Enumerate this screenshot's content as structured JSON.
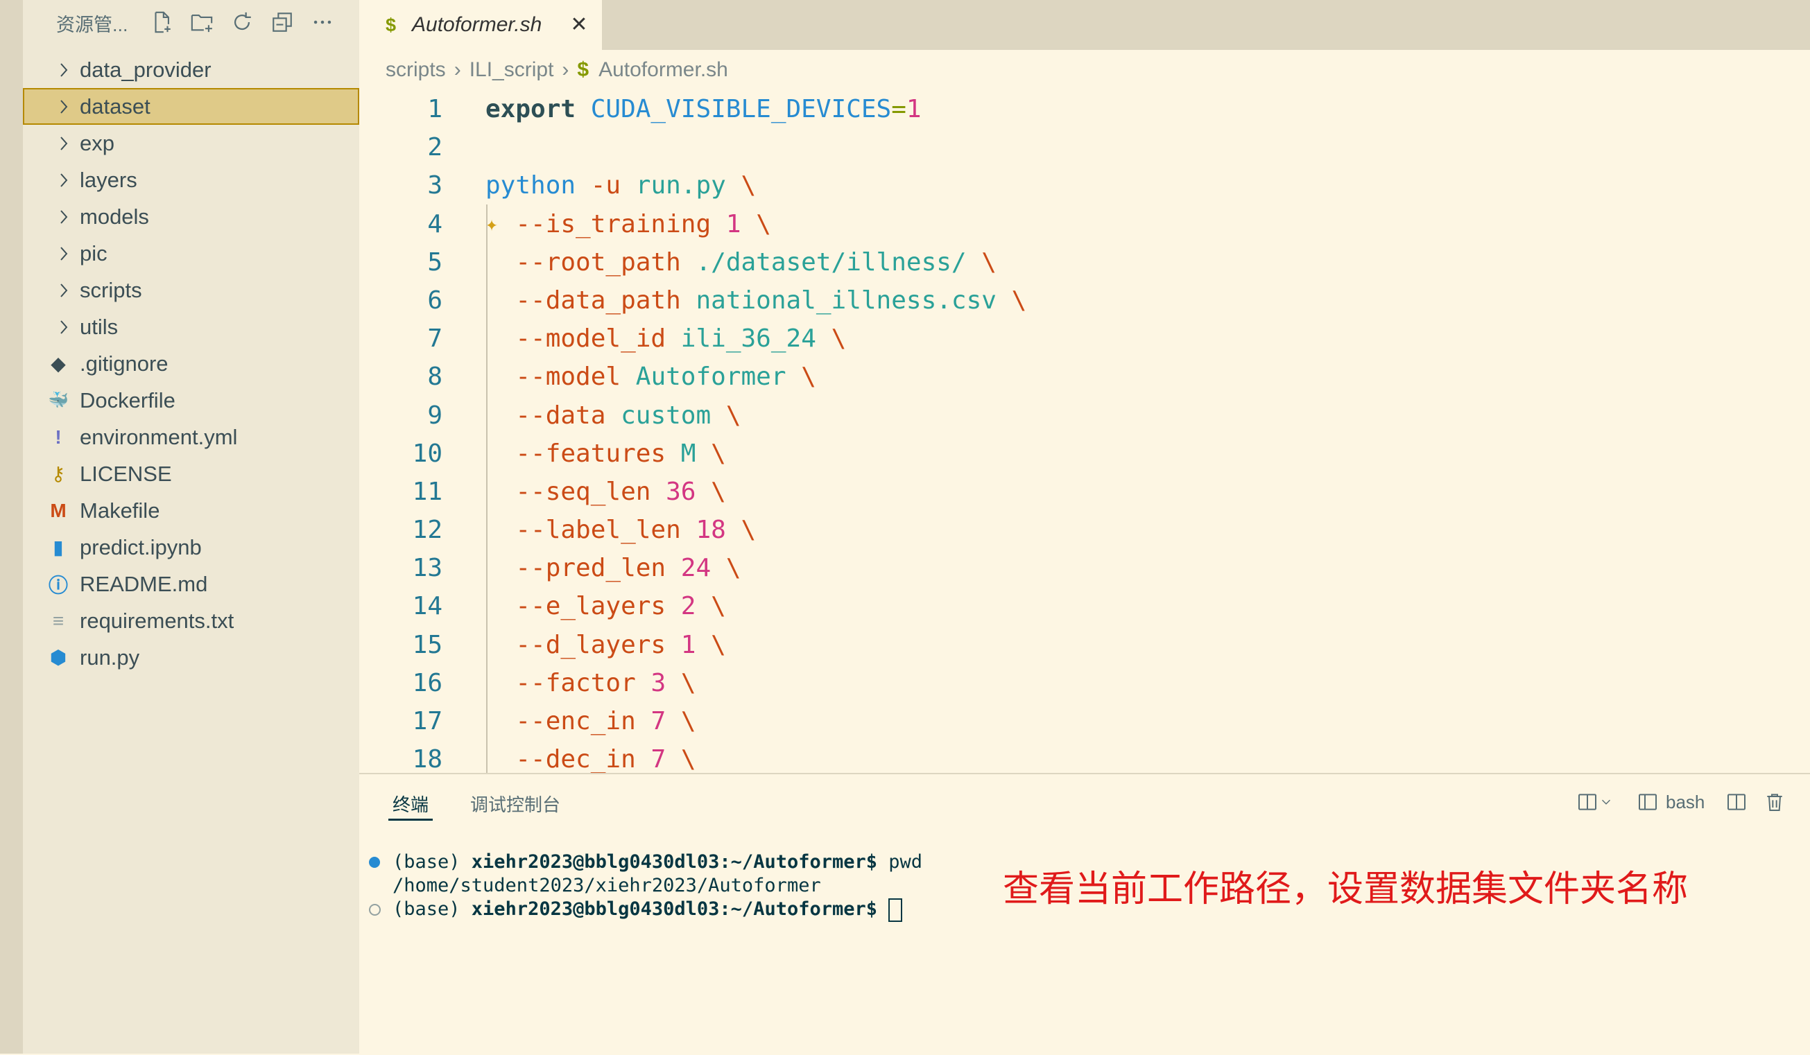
{
  "sidebar": {
    "title": "资源管...",
    "tools": [
      "new-file-icon",
      "new-folder-icon",
      "refresh-icon",
      "collapse-icon",
      "more-icon"
    ],
    "items": [
      {
        "label": "data_provider",
        "kind": "folder"
      },
      {
        "label": "dataset",
        "kind": "folder",
        "selected": true
      },
      {
        "label": "exp",
        "kind": "folder"
      },
      {
        "label": "layers",
        "kind": "folder"
      },
      {
        "label": "models",
        "kind": "folder"
      },
      {
        "label": "pic",
        "kind": "folder"
      },
      {
        "label": "scripts",
        "kind": "folder"
      },
      {
        "label": "utils",
        "kind": "folder"
      },
      {
        "label": ".gitignore",
        "kind": "git"
      },
      {
        "label": "Dockerfile",
        "kind": "docker"
      },
      {
        "label": "environment.yml",
        "kind": "yml"
      },
      {
        "label": "LICENSE",
        "kind": "license"
      },
      {
        "label": "Makefile",
        "kind": "makefile"
      },
      {
        "label": "predict.ipynb",
        "kind": "notebook"
      },
      {
        "label": "README.md",
        "kind": "info"
      },
      {
        "label": "requirements.txt",
        "kind": "text"
      },
      {
        "label": "run.py",
        "kind": "python"
      }
    ]
  },
  "editor": {
    "tab": {
      "icon": "$",
      "label": "Autoformer.sh"
    },
    "breadcrumb": [
      "scripts",
      "ILI_script",
      "Autoformer.sh"
    ],
    "lines": [
      {
        "n": "1",
        "tokens": [
          [
            "kw",
            "export"
          ],
          [
            "",
            " "
          ],
          [
            "var",
            "CUDA_VISIBLE_DEVICES"
          ],
          [
            "op",
            "="
          ],
          [
            "num",
            "1"
          ]
        ]
      },
      {
        "n": "2",
        "tokens": []
      },
      {
        "n": "3",
        "tokens": [
          [
            "var",
            "python"
          ],
          [
            "",
            " "
          ],
          [
            "flag",
            "-u"
          ],
          [
            "",
            " "
          ],
          [
            "str",
            "run.py"
          ],
          [
            "",
            " "
          ],
          [
            "bs",
            "\\"
          ]
        ]
      },
      {
        "n": "4",
        "tokens": [
          [
            "",
            "  "
          ],
          [
            "flag",
            "--is_training"
          ],
          [
            "",
            " "
          ],
          [
            "num",
            "1"
          ],
          [
            "",
            " "
          ],
          [
            "bs",
            "\\"
          ]
        ]
      },
      {
        "n": "5",
        "tokens": [
          [
            "",
            "  "
          ],
          [
            "flag",
            "--root_path"
          ],
          [
            "",
            " "
          ],
          [
            "str",
            "./dataset/illness/"
          ],
          [
            "",
            " "
          ],
          [
            "bs",
            "\\"
          ]
        ]
      },
      {
        "n": "6",
        "tokens": [
          [
            "",
            "  "
          ],
          [
            "flag",
            "--data_path"
          ],
          [
            "",
            " "
          ],
          [
            "str",
            "national_illness.csv"
          ],
          [
            "",
            " "
          ],
          [
            "bs",
            "\\"
          ]
        ]
      },
      {
        "n": "7",
        "tokens": [
          [
            "",
            "  "
          ],
          [
            "flag",
            "--model_id"
          ],
          [
            "",
            " "
          ],
          [
            "str",
            "ili_36_24"
          ],
          [
            "",
            " "
          ],
          [
            "bs",
            "\\"
          ]
        ]
      },
      {
        "n": "8",
        "tokens": [
          [
            "",
            "  "
          ],
          [
            "flag",
            "--model"
          ],
          [
            "",
            " "
          ],
          [
            "str",
            "Autoformer"
          ],
          [
            "",
            " "
          ],
          [
            "bs",
            "\\"
          ]
        ]
      },
      {
        "n": "9",
        "tokens": [
          [
            "",
            "  "
          ],
          [
            "flag",
            "--data"
          ],
          [
            "",
            " "
          ],
          [
            "str",
            "custom"
          ],
          [
            "",
            " "
          ],
          [
            "bs",
            "\\"
          ]
        ]
      },
      {
        "n": "10",
        "tokens": [
          [
            "",
            "  "
          ],
          [
            "flag",
            "--features"
          ],
          [
            "",
            " "
          ],
          [
            "str",
            "M"
          ],
          [
            "",
            " "
          ],
          [
            "bs",
            "\\"
          ]
        ]
      },
      {
        "n": "11",
        "tokens": [
          [
            "",
            "  "
          ],
          [
            "flag",
            "--seq_len"
          ],
          [
            "",
            " "
          ],
          [
            "num",
            "36"
          ],
          [
            "",
            " "
          ],
          [
            "bs",
            "\\"
          ]
        ]
      },
      {
        "n": "12",
        "tokens": [
          [
            "",
            "  "
          ],
          [
            "flag",
            "--label_len"
          ],
          [
            "",
            " "
          ],
          [
            "num",
            "18"
          ],
          [
            "",
            " "
          ],
          [
            "bs",
            "\\"
          ]
        ]
      },
      {
        "n": "13",
        "tokens": [
          [
            "",
            "  "
          ],
          [
            "flag",
            "--pred_len"
          ],
          [
            "",
            " "
          ],
          [
            "num",
            "24"
          ],
          [
            "",
            " "
          ],
          [
            "bs",
            "\\"
          ]
        ]
      },
      {
        "n": "14",
        "tokens": [
          [
            "",
            "  "
          ],
          [
            "flag",
            "--e_layers"
          ],
          [
            "",
            " "
          ],
          [
            "num",
            "2"
          ],
          [
            "",
            " "
          ],
          [
            "bs",
            "\\"
          ]
        ]
      },
      {
        "n": "15",
        "tokens": [
          [
            "",
            "  "
          ],
          [
            "flag",
            "--d_layers"
          ],
          [
            "",
            " "
          ],
          [
            "num",
            "1"
          ],
          [
            "",
            " "
          ],
          [
            "bs",
            "\\"
          ]
        ]
      },
      {
        "n": "16",
        "tokens": [
          [
            "",
            "  "
          ],
          [
            "flag",
            "--factor"
          ],
          [
            "",
            " "
          ],
          [
            "num",
            "3"
          ],
          [
            "",
            " "
          ],
          [
            "bs",
            "\\"
          ]
        ]
      },
      {
        "n": "17",
        "tokens": [
          [
            "",
            "  "
          ],
          [
            "flag",
            "--enc_in"
          ],
          [
            "",
            " "
          ],
          [
            "num",
            "7"
          ],
          [
            "",
            " "
          ],
          [
            "bs",
            "\\"
          ]
        ]
      },
      {
        "n": "18",
        "tokens": [
          [
            "",
            "  "
          ],
          [
            "flag",
            "--dec_in"
          ],
          [
            "",
            " "
          ],
          [
            "num",
            "7"
          ],
          [
            "",
            " "
          ],
          [
            "bs",
            "\\"
          ]
        ]
      }
    ]
  },
  "panel": {
    "tabs": {
      "terminal": "终端",
      "debug": "调试控制台"
    },
    "shell_label": "bash",
    "terminal": [
      {
        "marker": "filled",
        "prefix": "(base) ",
        "user": "xiehr2023@bblg0430dl03",
        "path": ":~/Autoformer$",
        "cmd": " pwd"
      },
      {
        "marker": "",
        "text": "/home/student2023/xiehr2023/Autoformer"
      },
      {
        "marker": "hollow",
        "prefix": "(base) ",
        "user": "xiehr2023@bblg0430dl03",
        "path": ":~/Autoformer$",
        "cmd": " ",
        "cursor": true
      }
    ]
  },
  "annotation": {
    "text": "查看当前工作路径，设置数据集文件夹名称",
    "color": "#e01a1a"
  },
  "colors": {
    "background": "#fdf6e3",
    "sidebar": "#eee8d5",
    "selection": "#dfca88",
    "accent": "#b58900"
  }
}
